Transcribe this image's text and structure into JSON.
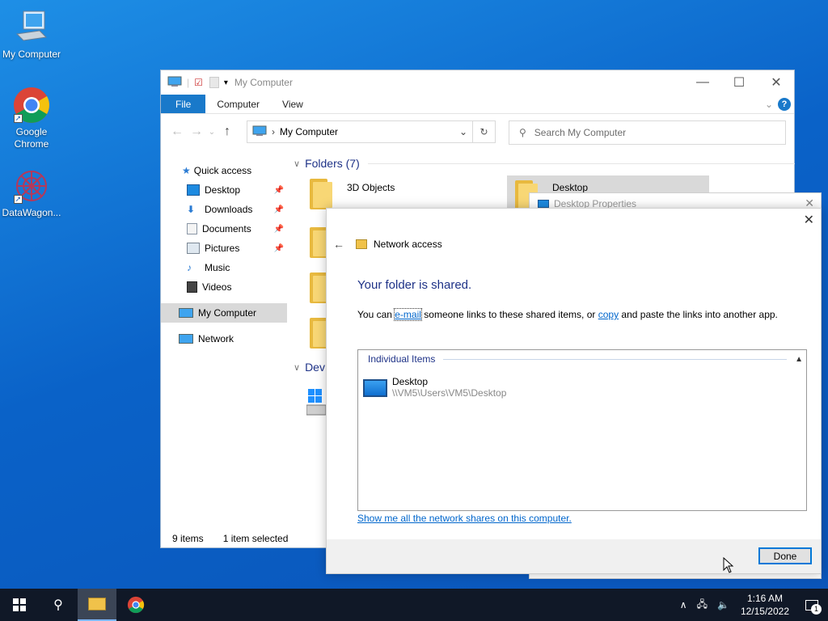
{
  "desktop": {
    "icons": [
      {
        "label": "My Computer",
        "icon": "computer-icon"
      },
      {
        "label": "Google Chrome",
        "icon": "chrome-icon"
      },
      {
        "label": "DataWagon...",
        "icon": "datawagon-icon"
      }
    ]
  },
  "explorer": {
    "title": "My Computer",
    "ribbon_tabs": [
      "File",
      "Computer",
      "View"
    ],
    "address": "My Computer",
    "search_placeholder": "Search My Computer",
    "nav": [
      {
        "label": "Quick access",
        "icon": "star-icon"
      },
      {
        "label": "Desktop",
        "icon": "desktop-icon",
        "pinned": true
      },
      {
        "label": "Downloads",
        "icon": "download-icon",
        "pinned": true
      },
      {
        "label": "Documents",
        "icon": "documents-icon",
        "pinned": true
      },
      {
        "label": "Pictures",
        "icon": "pictures-icon",
        "pinned": true
      },
      {
        "label": "Music",
        "icon": "music-icon"
      },
      {
        "label": "Videos",
        "icon": "videos-icon"
      },
      {
        "label": "My Computer",
        "icon": "computer-icon",
        "selected": true
      },
      {
        "label": "Network",
        "icon": "network-icon"
      }
    ],
    "folders_header": "Folders (7)",
    "folders": [
      "3D Objects",
      "Desktop"
    ],
    "devices_header": "Dev",
    "status_items": "9 items",
    "status_selected": "1 item selected"
  },
  "props_dialog": {
    "title": "Desktop Properties"
  },
  "network_dialog": {
    "header": "Network access",
    "heading": "Your folder is shared.",
    "desc_before": "You can ",
    "desc_email": "e-mail",
    "desc_mid": " someone links to these shared items, or ",
    "desc_copy": "copy",
    "desc_after": " and paste the links into another app.",
    "items_header": "Individual Items",
    "item_name": "Desktop",
    "item_path": "\\\\VM5\\Users\\VM5\\Desktop",
    "shares_link": "Show me all the network shares on this computer.",
    "done_label": "Done"
  },
  "taskbar": {
    "time": "1:16 AM",
    "date": "12/15/2022",
    "notification_count": "1"
  },
  "colors": {
    "accent": "#0078d7",
    "heading_blue": "#1e3287",
    "taskbar": "#101827"
  }
}
